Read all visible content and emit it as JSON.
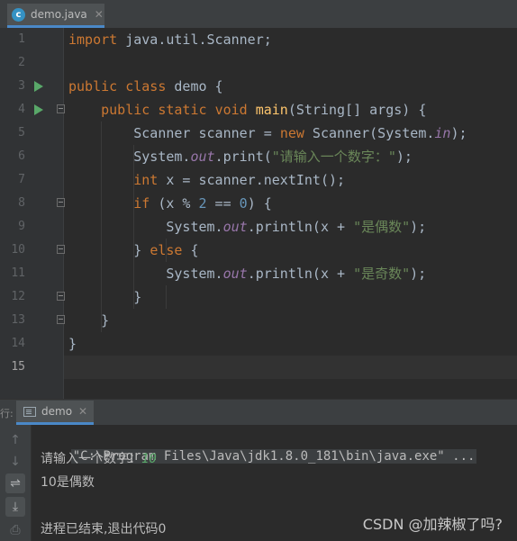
{
  "editor_tab": {
    "icon": "c",
    "filename": "demo.java",
    "close_glyph": "✕"
  },
  "editor": {
    "current_line": 15,
    "line_numbers": [
      "1",
      "2",
      "3",
      "4",
      "5",
      "6",
      "7",
      "8",
      "9",
      "10",
      "11",
      "12",
      "13",
      "14",
      "15"
    ],
    "code": {
      "l1": {
        "kw": "import",
        "rest": " java.util.Scanner;"
      },
      "l3": {
        "kw1": "public",
        "kw2": "class",
        "rest": " demo {"
      },
      "l4": {
        "kw1": "public",
        "kw2": "static",
        "kw3": "void",
        "method": "main",
        "rest": "(String[] args) {"
      },
      "l5": {
        "a": "Scanner scanner = ",
        "kw": "new",
        "b": " Scanner(System.",
        "field": "in",
        "c": ");"
      },
      "l6": {
        "a": "System.",
        "field": "out",
        "b": ".print(",
        "str": "\"请输入一个数字：\"",
        "c": ");"
      },
      "l7": {
        "kw": "int",
        "rest": " x = scanner.nextInt();"
      },
      "l8": {
        "kw": "if",
        "a": " (x % ",
        "num1": "2",
        "b": " == ",
        "num2": "0",
        "c": ") {"
      },
      "l9": {
        "a": "System.",
        "field": "out",
        "b": ".println(x + ",
        "str": "\"是偶数\"",
        "c": ");"
      },
      "l10": {
        "a": "} ",
        "kw": "else",
        "b": " {"
      },
      "l11": {
        "a": "System.",
        "field": "out",
        "b": ".println(x + ",
        "str": "\"是奇数\"",
        "c": ");"
      },
      "l12": {
        "a": "}"
      },
      "l13": {
        "a": "}"
      },
      "l14": {
        "a": "}"
      }
    }
  },
  "run_window": {
    "side_label": "行:",
    "tab_label": "demo",
    "close_glyph": "✕",
    "toolbar": [
      {
        "name": "scroll-up-icon",
        "glyph": "↑"
      },
      {
        "name": "scroll-down-icon",
        "glyph": "↓"
      },
      {
        "name": "soft-wrap-icon",
        "glyph": "⇌"
      },
      {
        "name": "scroll-to-end-icon",
        "glyph": "⤓"
      },
      {
        "name": "print-icon",
        "glyph": "⎙"
      }
    ],
    "console": {
      "command": "\"C:\\Program Files\\Java\\jdk1.8.0_181\\bin\\java.exe\" ...",
      "prompt": "请输入一个数字：",
      "user_input": "10",
      "result": "10是偶数",
      "exit_message": "进程已结束,退出代码0"
    }
  },
  "watermark": "CSDN @加辣椒了吗?"
}
